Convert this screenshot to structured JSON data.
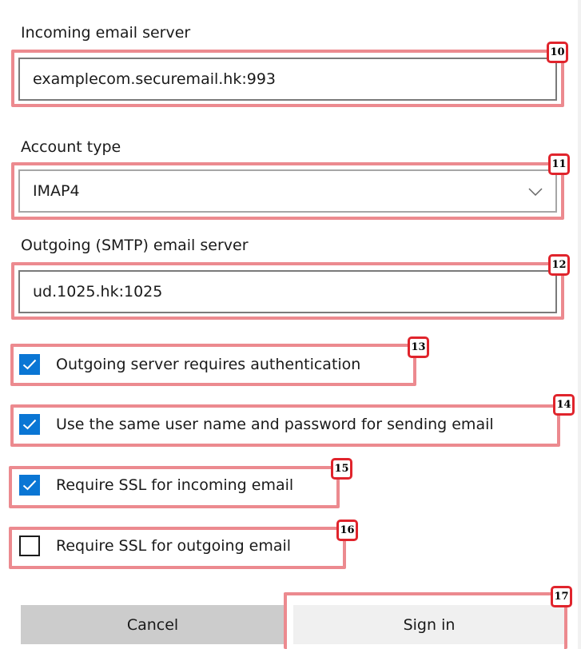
{
  "incoming": {
    "label": "Incoming email server",
    "value": "examplecom.securemail.hk:993",
    "badge": "10"
  },
  "account_type": {
    "label": "Account type",
    "selected": "IMAP4",
    "badge": "11",
    "icon": "chevron-down-icon"
  },
  "outgoing": {
    "label": "Outgoing (SMTP) email server",
    "value": "ud.1025.hk:1025",
    "badge": "12"
  },
  "checkboxes": [
    {
      "label": "Outgoing server requires authentication",
      "checked": true,
      "badge": "13"
    },
    {
      "label": "Use the same user name and password for sending email",
      "checked": true,
      "badge": "14"
    },
    {
      "label": "Require SSL for incoming email",
      "checked": true,
      "badge": "15"
    },
    {
      "label": "Require SSL for outgoing email",
      "checked": false,
      "badge": "16"
    }
  ],
  "buttons": {
    "cancel_label": "Cancel",
    "signin_label": "Sign in",
    "signin_badge": "17"
  },
  "colors": {
    "accent": "#0a76d4",
    "highlight": "#ec8a8f",
    "badge_border": "#e0242c",
    "button_bg": "#cccccc"
  }
}
